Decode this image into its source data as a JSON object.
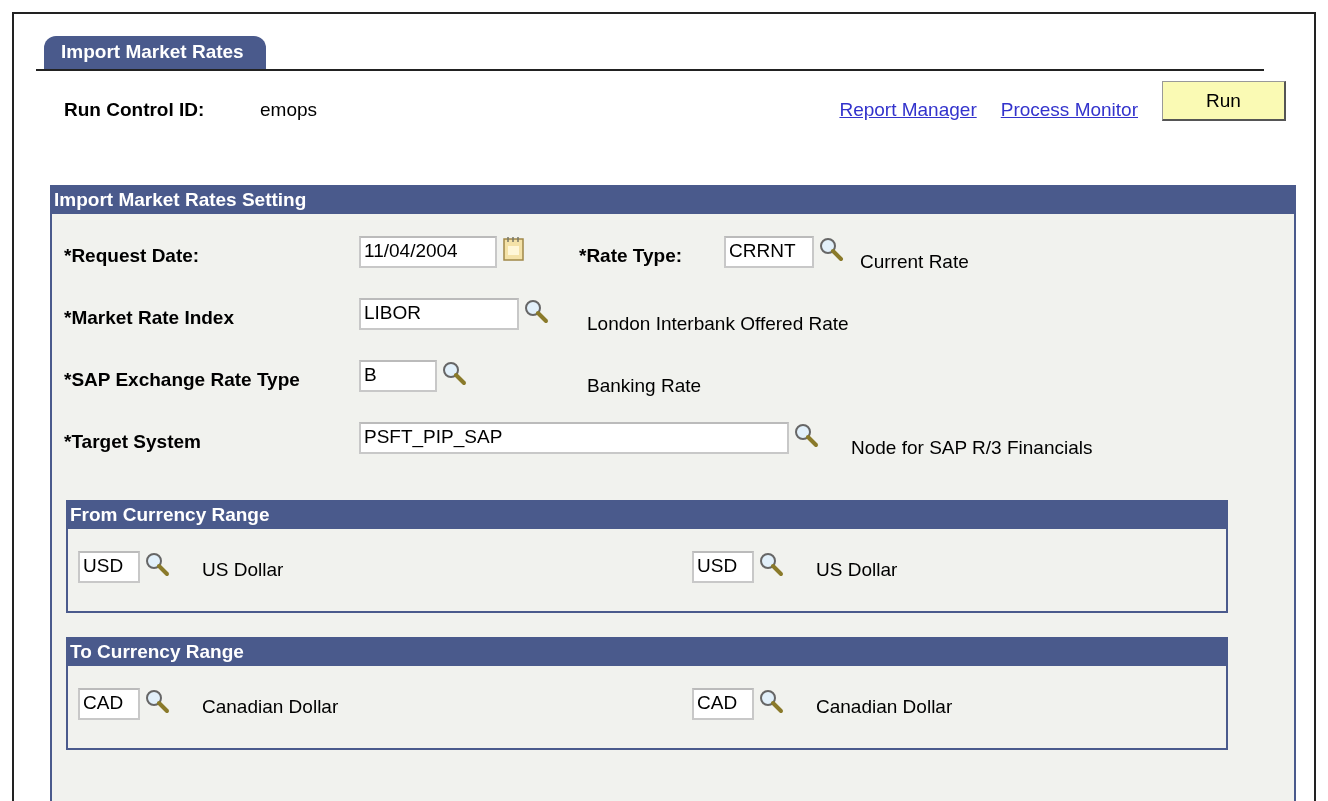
{
  "tabs": [
    {
      "label": "Import Market Rates",
      "selected": true
    }
  ],
  "run_control": {
    "label": "Run Control ID:",
    "value": "emops"
  },
  "links": [
    "Report Manager",
    "Process Monitor"
  ],
  "run_button": "Run",
  "section": {
    "title": "Import Market Rates Setting",
    "rows": [
      {
        "label": "*Request Date:",
        "value": "11/04/2004",
        "kind": "date",
        "extra_label": "*Rate Type:",
        "extra_value": "CRRNT",
        "description": "Current Rate"
      },
      {
        "label": "*Market Rate Index",
        "value": "LIBOR",
        "kind": "lookup",
        "description": "London Interbank Offered Rate"
      },
      {
        "label": "*SAP Exchange Rate Type",
        "value": "B",
        "kind": "lookup",
        "description": "Banking Rate"
      },
      {
        "label": "*Target System",
        "value": "PSFT_PIP_SAP",
        "kind": "lookup",
        "description": "Node for SAP R/3 Financials"
      }
    ],
    "ranges": [
      {
        "title": "From Currency Range",
        "items": [
          {
            "code": "USD",
            "description": "US Dollar"
          },
          {
            "code": "USD",
            "description": "US Dollar"
          }
        ]
      },
      {
        "title": "To Currency Range",
        "items": [
          {
            "code": "CAD",
            "description": "Canadian Dollar"
          },
          {
            "code": "CAD",
            "description": "Canadian Dollar"
          }
        ]
      }
    ]
  }
}
